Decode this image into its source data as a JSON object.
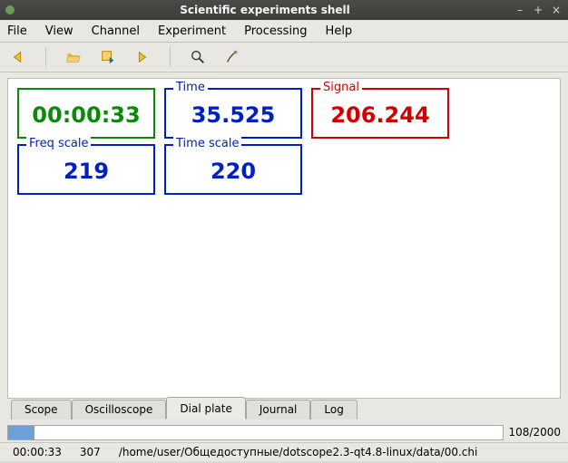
{
  "window": {
    "title": "Scientific experiments shell",
    "minimize": "–",
    "maximize": "+",
    "close": "×"
  },
  "menu": {
    "file": "File",
    "view": "View",
    "channel": "Channel",
    "experiment": "Experiment",
    "processing": "Processing",
    "help": "Help"
  },
  "toolbar_icons": {
    "back": "back-arrow-icon",
    "open": "folder-open-icon",
    "save": "save-export-icon",
    "forward": "forward-arrow-icon",
    "zoom": "magnifier-icon",
    "tool": "probe-tool-icon"
  },
  "readouts": {
    "elapsed": {
      "label": "",
      "value": "00:00:33"
    },
    "time": {
      "label": "Time",
      "value": "35.525"
    },
    "signal": {
      "label": "Signal",
      "value": "206.244"
    },
    "freq_scale": {
      "label": "Freq scale",
      "value": "219"
    },
    "time_scale": {
      "label": "Time scale",
      "value": "220"
    }
  },
  "tabs": {
    "scope": "Scope",
    "oscilloscope": "Oscilloscope",
    "dial_plate": "Dial plate",
    "journal": "Journal",
    "log": "Log",
    "active": "dial_plate"
  },
  "progress": {
    "current": 108,
    "total": 2000,
    "text": "108/2000",
    "percent": 5.4
  },
  "status": {
    "time": "00:00:33",
    "value": "307",
    "path": "/home/user/Общедоступные/dotscope2.3-qt4.8-linux/data/00.chi"
  }
}
